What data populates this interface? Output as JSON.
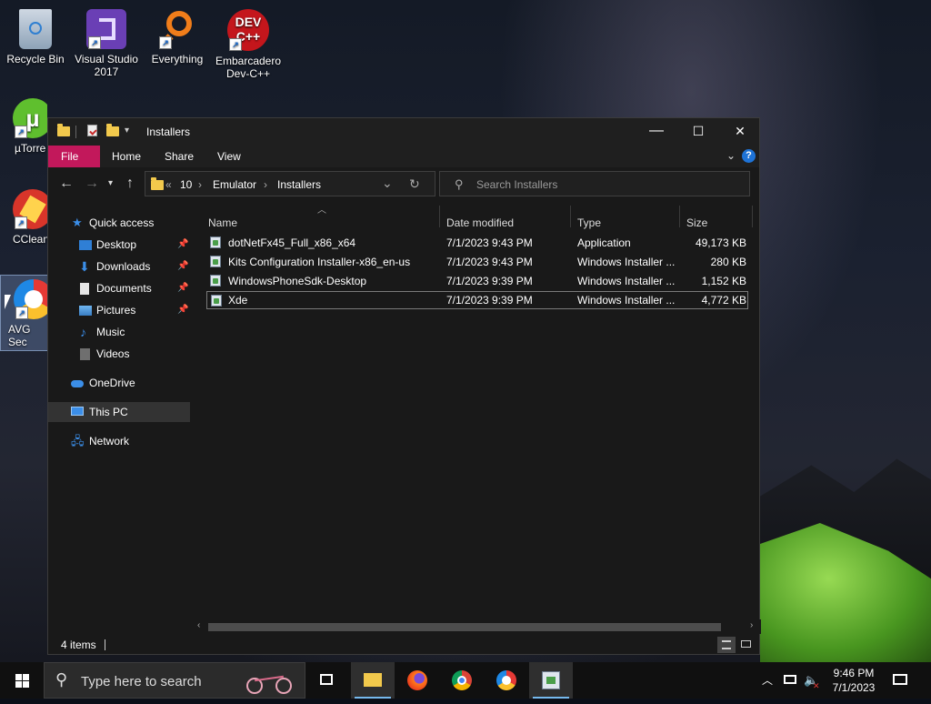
{
  "desktop": {
    "icons": [
      {
        "label": "Recycle Bin"
      },
      {
        "label": "Visual Studio 2017"
      },
      {
        "label": "Everything"
      },
      {
        "label": "Embarcadero Dev-C++"
      },
      {
        "label": "µTorre"
      },
      {
        "label": "CClean"
      },
      {
        "label": "AVG Sec Brows"
      }
    ]
  },
  "window": {
    "title": "Installers",
    "controls": {
      "minimize": "—",
      "maximize": "☐",
      "close": "✕"
    },
    "ribbon_tabs": [
      "File",
      "Home",
      "Share",
      "View"
    ],
    "help_label": "?",
    "address": {
      "overflow": "«",
      "segments": [
        "10",
        "Emulator",
        "Installers"
      ]
    },
    "search_placeholder": "Search Installers",
    "nav": [
      {
        "label": "Quick access"
      },
      {
        "label": "Desktop",
        "pinned": true
      },
      {
        "label": "Downloads",
        "pinned": true
      },
      {
        "label": "Documents",
        "pinned": true
      },
      {
        "label": "Pictures",
        "pinned": true
      },
      {
        "label": "Music"
      },
      {
        "label": "Videos"
      },
      {
        "label": "OneDrive"
      },
      {
        "label": "This PC",
        "selected": true
      },
      {
        "label": "Network"
      }
    ],
    "columns": [
      "Name",
      "Date modified",
      "Type",
      "Size"
    ],
    "files": [
      {
        "name": "dotNetFx45_Full_x86_x64",
        "date": "7/1/2023 9:43 PM",
        "type": "Application",
        "size": "49,173 KB"
      },
      {
        "name": "Kits Configuration Installer-x86_en-us",
        "date": "7/1/2023 9:43 PM",
        "type": "Windows Installer ...",
        "size": "280 KB"
      },
      {
        "name": "WindowsPhoneSdk-Desktop",
        "date": "7/1/2023 9:39 PM",
        "type": "Windows Installer ...",
        "size": "1,152 KB"
      },
      {
        "name": "Xde",
        "date": "7/1/2023 9:39 PM",
        "type": "Windows Installer ...",
        "size": "4,772 KB",
        "selected": true
      }
    ],
    "status": "4 items"
  },
  "taskbar": {
    "search_placeholder": "Type here to search",
    "time": "9:46 PM",
    "date": "7/1/2023"
  },
  "colors": {
    "file_tab": "#c2185b",
    "accent": "#1e73d6",
    "window_bg": "#191919"
  }
}
